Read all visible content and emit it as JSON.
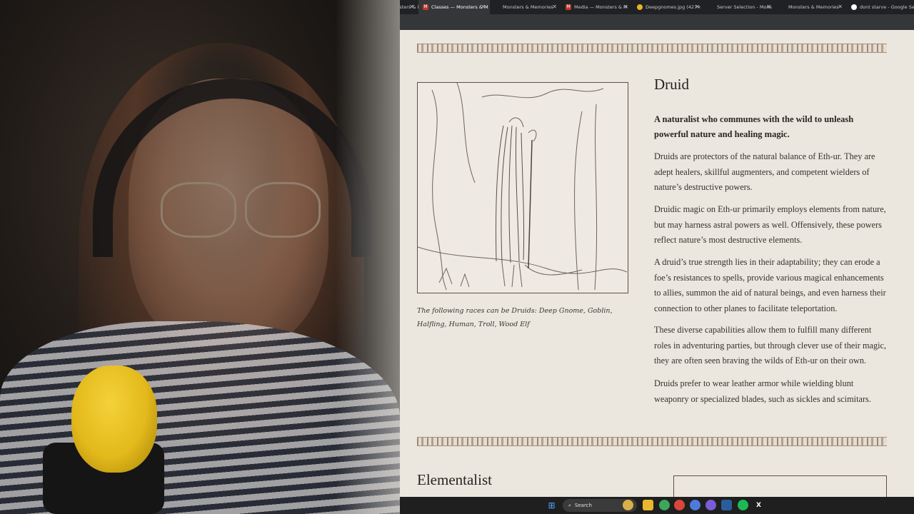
{
  "tabs": [
    {
      "label": "...ses — Monsters & M",
      "fav_color": "#8a8a8a",
      "active": false
    },
    {
      "label": "Classes — Monsters & M",
      "fav_color": "#c0392b",
      "active": true
    },
    {
      "label": "Monsters & Memories",
      "fav_color": "#2a2a2a",
      "active": false
    },
    {
      "label": "Media — Monsters & M",
      "fav_color": "#c0392b",
      "active": false
    },
    {
      "label": "Deepgnomes.jpg (427×",
      "fav_color": "#e6b422",
      "active": false
    },
    {
      "label": "Server Selection - Mons",
      "fav_color": "#2a2a2a",
      "active": false
    },
    {
      "label": "Monsters & Memories",
      "fav_color": "#2a2a2a",
      "active": false
    },
    {
      "label": "dont starve - Google Se",
      "fav_color": "#ffffff",
      "active": false
    }
  ],
  "page": {
    "class_title": "Druid",
    "lead": "A naturalist who communes with the wild to unleash powerful nature and healing magic.",
    "paragraphs": [
      "Druids are protectors of the natural balance of Eth-ur. They are adept healers, skillful augmenters, and competent wielders of nature’s destructive powers.",
      "Druidic magic on Eth-ur primarily employs elements from nature, but may harness astral powers as well. Offensively, these powers reflect nature’s most destructive elements.",
      "A druid’s true strength lies in their adaptability; they can erode a foe’s resistances to spells, provide various magical enhancements to allies, summon the aid of natural beings, and even harness their connection to other planes to facilitate teleportation.",
      "These diverse capabilities allow them to fulfill many different roles in adventuring parties, but through clever use of their magic, they are often seen braving the wilds of Eth-ur on their own.",
      "Druids prefer to wear leather armor while wielding blunt weaponry or specialized blades, such as sickles and scimitars."
    ],
    "caption": "The following races can be Druids: Deep Gnome, Goblin, Halfling, Human, Troll, Wood Elf",
    "next_class_title": "Elementalist"
  },
  "taskbar": {
    "search_label": "Search",
    "icons": [
      "windows-start-icon",
      "widgets-icon",
      "file-explorer-icon",
      "chrome-icon",
      "chrome-icon-2",
      "app-icon",
      "discord-icon",
      "steam-icon",
      "spotify-icon",
      "x-icon"
    ]
  }
}
